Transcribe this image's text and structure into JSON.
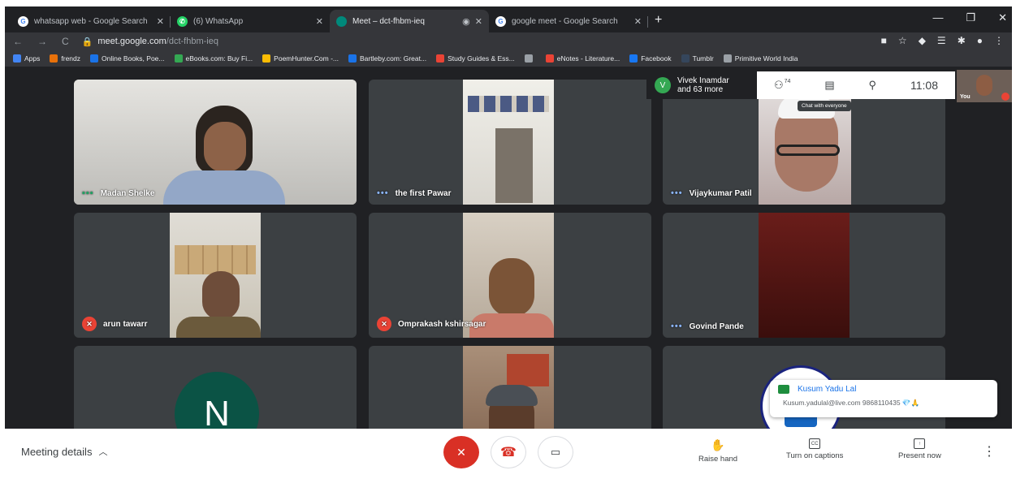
{
  "browser": {
    "tabs": [
      {
        "title": "whatsapp web - Google Search",
        "icon": "google-icon",
        "color": "#4285f4",
        "active": false
      },
      {
        "title": "(6) WhatsApp",
        "icon": "whatsapp-icon",
        "color": "#25d366",
        "active": false
      },
      {
        "title": "Meet – dct-fhbm-ieq",
        "icon": "meet-icon",
        "color": "#00897b",
        "active": true
      },
      {
        "title": "google meet - Google Search",
        "icon": "google-icon",
        "color": "#4285f4",
        "active": false
      }
    ],
    "new_tab": "+",
    "url_host": "meet.google.com",
    "url_path": "/dct-fhbm-ieq",
    "bookmarks": [
      {
        "label": "Apps",
        "color": "#4285f4"
      },
      {
        "label": "frendz",
        "color": "#e8710a"
      },
      {
        "label": "Online Books, Poe...",
        "color": "#1a73e8"
      },
      {
        "label": "eBooks.com: Buy Fi...",
        "color": "#34a853"
      },
      {
        "label": "PoemHunter.Com -...",
        "color": "#fbbc04"
      },
      {
        "label": "Bartleby.com: Great...",
        "color": "#1a73e8"
      },
      {
        "label": "Study Guides & Ess...",
        "color": "#ea4335"
      },
      {
        "label": "",
        "color": "#9aa0a6"
      },
      {
        "label": "eNotes - Literature...",
        "color": "#ea4335"
      },
      {
        "label": "Facebook",
        "color": "#1877f2"
      },
      {
        "label": "Tumblr",
        "color": "#35465c"
      },
      {
        "label": "Primitive World India",
        "color": "#9aa0a6"
      }
    ]
  },
  "meet": {
    "participants_line1": "Vivek Inamdar",
    "participants_line2": "and 63 more",
    "participant_avatar": "V",
    "people_count": "74",
    "clock": "11:08",
    "tooltip": "Chat with everyone",
    "self_label": "You",
    "tiles": [
      {
        "name": "Madan Shelke",
        "status": "speaking"
      },
      {
        "name": "the first Pawar",
        "status": "dots"
      },
      {
        "name": "Vijaykumar Patil",
        "status": "dots"
      },
      {
        "name": "arun tawarr",
        "status": "muted"
      },
      {
        "name": "Omprakash kshirsagar",
        "status": "muted"
      },
      {
        "name": "Govind Pande",
        "status": "dots"
      },
      {
        "name": "",
        "status": "avatar",
        "avatar_letter": "N"
      },
      {
        "name": "",
        "status": "video"
      },
      {
        "name": "",
        "status": "logo"
      }
    ],
    "chat_toast": {
      "sender": "Kusum Yadu Lal",
      "message": "Kusum.yadulal@live.com  9868110435 💎🙏"
    },
    "bottom": {
      "meeting_details": "Meeting details",
      "raise_hand": "Raise hand",
      "captions": "Turn on captions",
      "present": "Present now"
    }
  }
}
